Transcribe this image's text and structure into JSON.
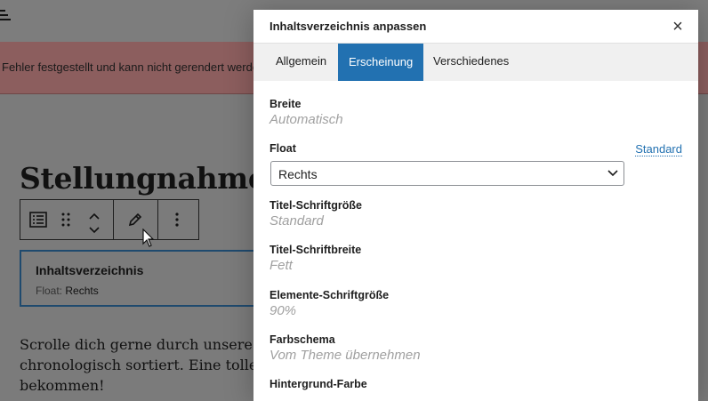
{
  "background": {
    "notice": "Fehler festgestellt und kann nicht gerendert werde",
    "heading": "Stellungnahmen",
    "block": {
      "title": "Inhaltsverzeichnis",
      "float_label": "Float:",
      "float_value": "Rechts"
    },
    "paragraph_lines": [
      "Scrolle dich gerne durch unsere Ve",
      "chronologisch sortiert. Eine tolle C",
      "bekommen!"
    ]
  },
  "modal": {
    "title": "Inhaltsverzeichnis anpassen",
    "close_symbol": "×",
    "tabs": [
      {
        "label": "Allgemein"
      },
      {
        "label": "Erscheinung"
      },
      {
        "label": "Verschiedenes"
      }
    ],
    "active_tab": "Erscheinung",
    "fields": {
      "breite": {
        "label": "Breite",
        "value": "Automatisch"
      },
      "float": {
        "label": "Float",
        "selected": "Rechts",
        "reset": "Standard"
      },
      "titel_schriftgroesse": {
        "label": "Titel-Schriftgröße",
        "value": "Standard"
      },
      "titel_schriftbreite": {
        "label": "Titel-Schriftbreite",
        "value": "Fett"
      },
      "elemente_schriftgroesse": {
        "label": "Elemente-Schriftgröße",
        "value": "90%"
      },
      "farbschema": {
        "label": "Farbschema",
        "value": "Vom Theme übernehmen"
      },
      "hintergrund_farbe": {
        "label": "Hintergrund-Farbe"
      }
    }
  },
  "colors": {
    "accent": "#2271b1",
    "overlay": "#7b7b7b"
  },
  "icons": [
    "menu-icon",
    "table-of-contents-icon",
    "drag-handle-icon",
    "move-up-icon",
    "move-down-icon",
    "edit-pencil-icon",
    "more-options-icon",
    "close-icon",
    "chevron-down-icon",
    "mouse-cursor"
  ]
}
